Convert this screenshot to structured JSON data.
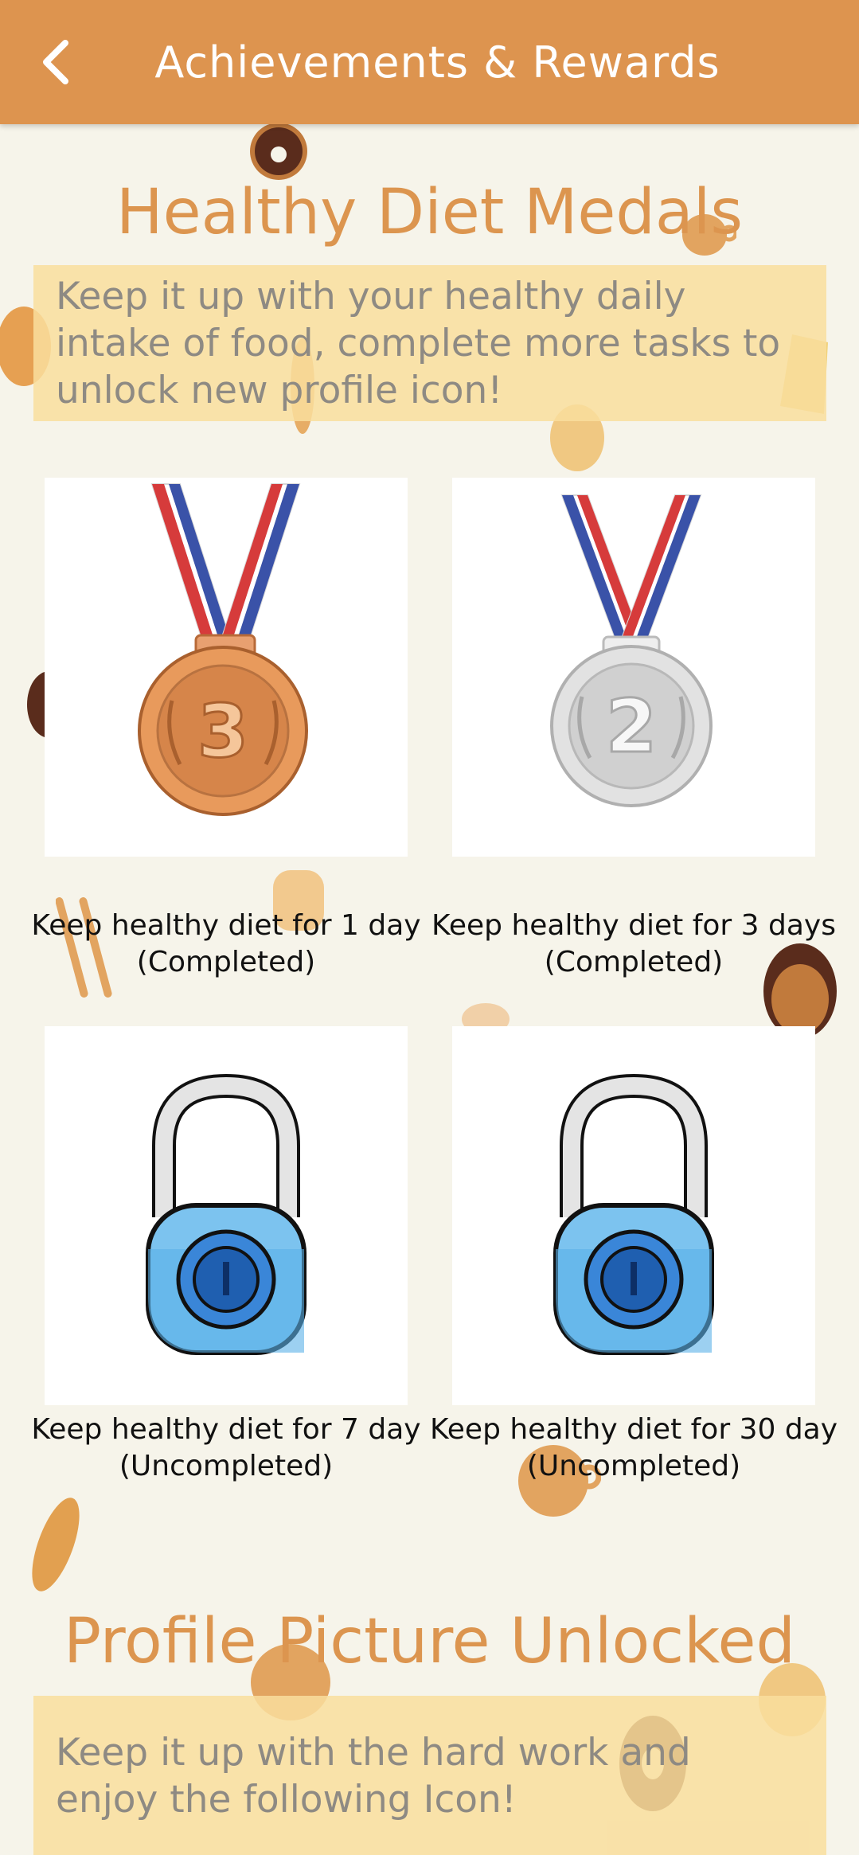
{
  "header": {
    "title": "Achievements & Rewards",
    "back_icon": "back-arrow-icon"
  },
  "medals_section": {
    "title": "Healthy Diet Medals",
    "description": "Keep it up with your healthy daily intake of food, complete more tasks to unlock new profile icon!",
    "medals": [
      {
        "icon": "bronze-medal-icon",
        "number": "3",
        "line1": "Keep healthy diet for 1 day",
        "line2": "(Completed)"
      },
      {
        "icon": "silver-medal-icon",
        "number": "2",
        "line1": "Keep healthy diet for 3 days",
        "line2": "(Completed)"
      },
      {
        "icon": "lock-icon",
        "line1": "Keep healthy diet for 7 day",
        "line2": "(Uncompleted)"
      },
      {
        "icon": "lock-icon",
        "line1": "Keep healthy diet for 30 day",
        "line2": "(Uncompleted)"
      }
    ]
  },
  "profile_section": {
    "title": "Profile Picture Unlocked",
    "description": "Keep it up with the hard work and enjoy the following Icon!"
  },
  "colors": {
    "appbar": "#dd944f",
    "accent_title": "#dc954f",
    "banner": "#f9de9d",
    "background": "#f6f4ea"
  }
}
